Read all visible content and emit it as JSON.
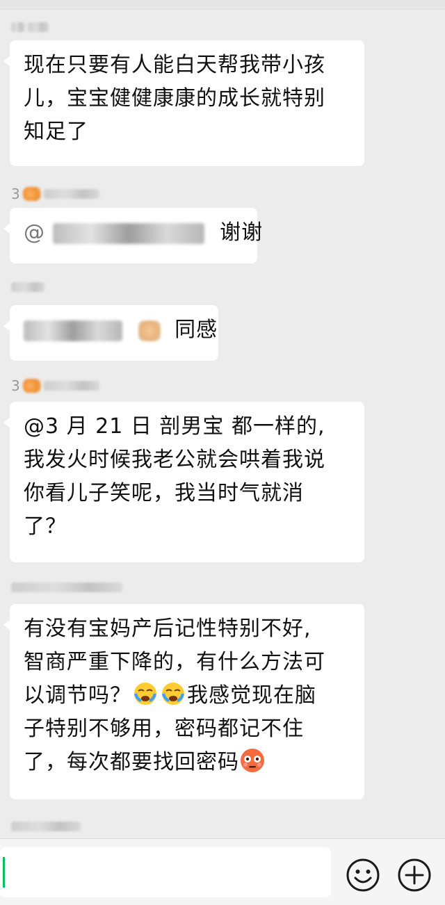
{
  "messages": [
    {
      "text_lines": [
        "现在只要有人能白天帮我带小孩",
        "儿，宝宝健健康康的成长就特别",
        "知足了"
      ]
    },
    {
      "sender_prefix": "3",
      "mention_prefix": "@",
      "text": "谢谢"
    },
    {
      "text": "同感"
    },
    {
      "sender_prefix": "3",
      "text_lines": [
        "@3 月 21 日  剖男宝  都一样的,",
        "我发火时候我老公就会哄着我说",
        "你看儿子笑呢，我当时气就消",
        "了？"
      ]
    },
    {
      "text_lines": [
        "有没有宝妈产后记性特别不好,",
        "智商严重下降的，有什么方法可"
      ],
      "line3_before": "以调节吗？",
      "line3_after": "我感觉现在脑",
      "line4": "子特别不够用，密码都记不住",
      "line5": "了，每次都要找回密码"
    }
  ],
  "icons": {
    "emoji_button": "smiley-face-icon",
    "more_button": "plus-circle-icon",
    "cry_emoji": "crying-face-emoji",
    "flushed_emoji": "flushed-face-emoji"
  },
  "colors": {
    "background": "#ececec",
    "bubble": "#ffffff",
    "caret": "#07c160"
  }
}
